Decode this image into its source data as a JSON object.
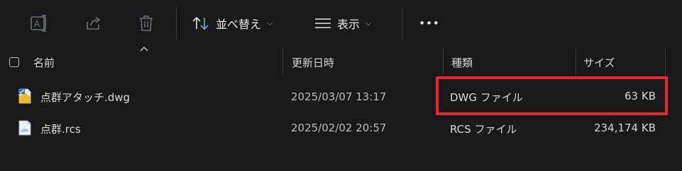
{
  "toolbar": {
    "icons": [
      "rename-icon",
      "share-icon",
      "delete-icon"
    ],
    "sort_label": "並べ替え",
    "view_label": "表示",
    "more_label": "•••"
  },
  "columns": {
    "name": "名前",
    "modified": "更新日時",
    "type": "種類",
    "size": "サイズ"
  },
  "files": [
    {
      "name": "点群アタッチ.dwg",
      "modified": "2025/03/07 13:17",
      "type": "DWG ファイル",
      "size": "63 KB",
      "icon": "dwg-file-icon"
    },
    {
      "name": "点群.rcs",
      "modified": "2025/02/02 20:57",
      "type": "RCS ファイル",
      "size": "234,174 KB",
      "icon": "rcs-file-icon"
    }
  ],
  "highlight_color": "#e8262c"
}
